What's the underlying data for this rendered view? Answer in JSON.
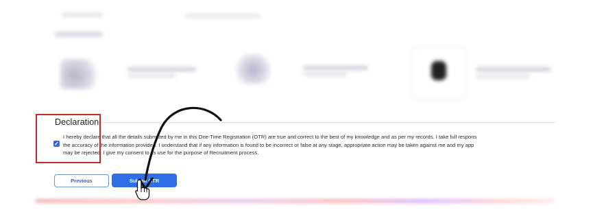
{
  "declaration": {
    "title": "Declaration",
    "checkbox_checked": true,
    "text_lines": [
      "I hereby declare that all the details submitted by me in this One-Time Registration (OTR) are true and correct to the best of my knowledge and as per my records. I take full respons",
      "the accuracy of the information provided. I understand that if any information is found to be incorrect or false at any stage, appropriate action may be taken against me and my app",
      "may be rejected. I give my consent to its use for the purpose of Recruitment process."
    ]
  },
  "buttons": {
    "previous_label": "Previous",
    "submit_label": "Submit OTR"
  },
  "colors": {
    "accent": "#2e6ee6",
    "highlight_border": "#c62828",
    "arrow": "#111111"
  },
  "icons": {
    "check": "✓",
    "cursor": "hand-pointer-icon",
    "annotation": "curved-arrow-icon"
  }
}
